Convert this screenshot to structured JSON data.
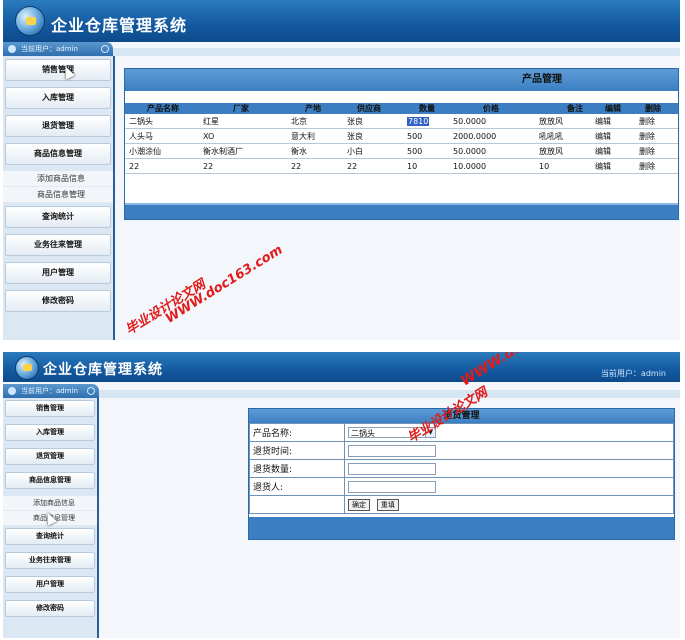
{
  "app_title": "企业仓库管理系统",
  "current_user": "当前用户：admin",
  "sidebar": {
    "items": [
      "销售管理",
      "入库管理",
      "退货管理",
      "商品信息管理"
    ],
    "sub_items": [
      "添加商品信息",
      "商品信息管理"
    ],
    "items_after": [
      "查询统计",
      "业务往来管理",
      "用户管理",
      "修改密码"
    ]
  },
  "product_panel": {
    "title": "产品管理",
    "columns": [
      "产品名称",
      "厂家",
      "产地",
      "供应商",
      "数量",
      "价格",
      "备注",
      "编辑",
      "删除"
    ],
    "rows": [
      [
        "二锅头",
        "红星",
        "北京",
        "张良",
        "7810",
        "50.0000",
        "放放风",
        "编辑",
        "删除"
      ],
      [
        "人头马",
        "XO",
        "意大利",
        "张良",
        "500",
        "2000.0000",
        "吼吼吼",
        "编辑",
        "删除"
      ],
      [
        "小潮涂仙",
        "衡水制酒厂",
        "衡水",
        "小白",
        "500",
        "50.0000",
        "放放风",
        "编辑",
        "删除"
      ],
      [
        "22",
        "22",
        "22",
        "22",
        "10",
        "10.0000",
        "10",
        "编辑",
        "删除"
      ]
    ]
  },
  "return_panel": {
    "title": "退货管理",
    "fields": [
      "产品名称:",
      "退货时间:",
      "退货数量:",
      "退货人:"
    ],
    "product_select_value": "二锅头",
    "confirm_label": "确定",
    "reset_label": "重填"
  },
  "watermarks": {
    "site": "WWW.doc163.com",
    "cn": "毕业设计论文网"
  },
  "colors": {
    "header": "#1459a0",
    "panel_bar": "#3b7fc2",
    "sidebar_bg": "#dbe7f2",
    "watermark": "#e21a1a"
  }
}
